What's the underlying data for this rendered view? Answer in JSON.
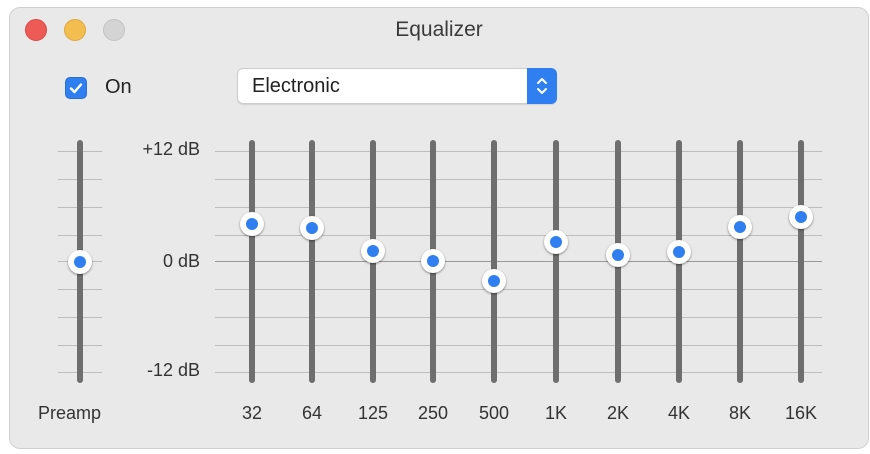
{
  "window": {
    "title": "Equalizer"
  },
  "controls": {
    "on_label": "On",
    "on_checked": true,
    "preset": "Electronic"
  },
  "scale": {
    "top": "+12 dB",
    "middle": "0 dB",
    "bottom": "-12 dB",
    "max_db": 12,
    "min_db": -12
  },
  "preamp": {
    "label": "Preamp",
    "value_db": 0
  },
  "bands": [
    {
      "label": "32",
      "value_db": 4.1
    },
    {
      "label": "64",
      "value_db": 3.6
    },
    {
      "label": "125",
      "value_db": 1.1
    },
    {
      "label": "250",
      "value_db": 0.1
    },
    {
      "label": "500",
      "value_db": -2.1
    },
    {
      "label": "1K",
      "value_db": 2.1
    },
    {
      "label": "2K",
      "value_db": 0.7
    },
    {
      "label": "4K",
      "value_db": 1.0
    },
    {
      "label": "8K",
      "value_db": 3.8
    },
    {
      "label": "16K",
      "value_db": 4.8
    }
  ],
  "colors": {
    "accent": "#2f7ff0",
    "track": "#6e6e6e",
    "close": "#ee5b56",
    "minimize": "#f3bd4f",
    "zoom": "#d4d4d4"
  }
}
